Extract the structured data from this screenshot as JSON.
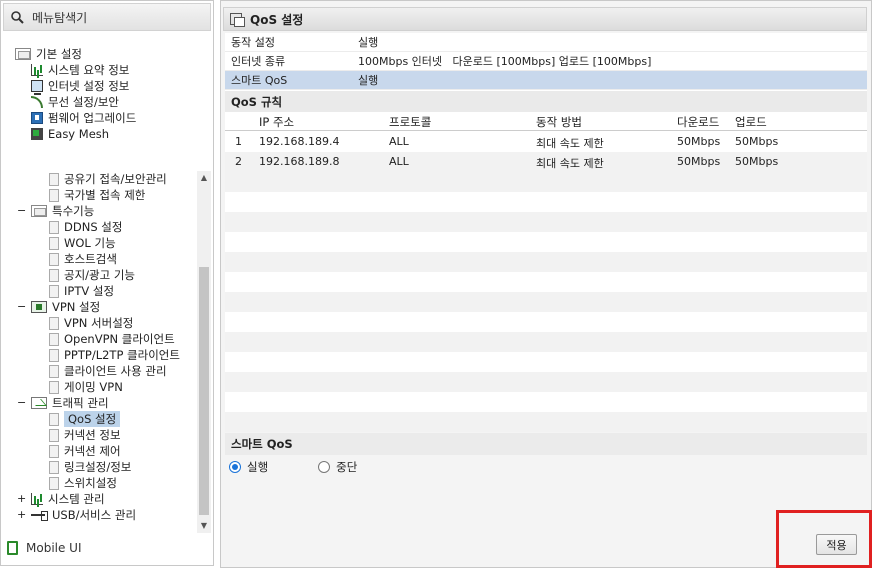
{
  "menu": {
    "title": "메뉴탐색기",
    "top_items": [
      {
        "label": "기본 설정",
        "icon": "folder-icon"
      },
      {
        "label": "시스템 요약 정보",
        "icon": "chart-icon"
      },
      {
        "label": "인터넷 설정 정보",
        "icon": "pc-icon"
      },
      {
        "label": "무선 설정/보안",
        "icon": "wifi-icon"
      },
      {
        "label": "펌웨어 업그레이드",
        "icon": "update-icon"
      },
      {
        "label": "Easy Mesh",
        "icon": "mesh-icon"
      }
    ],
    "tree": [
      {
        "label": "공유기 접속/보안관리",
        "type": "page"
      },
      {
        "label": "국가별 접속 제한",
        "type": "page"
      },
      {
        "label": "특수기능",
        "type": "folder",
        "toggle": "−"
      },
      {
        "label": "DDNS 설정",
        "type": "page"
      },
      {
        "label": "WOL 기능",
        "type": "page"
      },
      {
        "label": "호스트검색",
        "type": "page"
      },
      {
        "label": "공지/광고 기능",
        "type": "page"
      },
      {
        "label": "IPTV 설정",
        "type": "page"
      },
      {
        "label": "VPN 설정",
        "type": "vpn",
        "toggle": "−"
      },
      {
        "label": "VPN 서버설정",
        "type": "page"
      },
      {
        "label": "OpenVPN 클라이언트",
        "type": "page"
      },
      {
        "label": "PPTP/L2TP 클라이언트",
        "type": "page"
      },
      {
        "label": "클라이언트 사용 관리",
        "type": "page"
      },
      {
        "label": "게이밍 VPN",
        "type": "page"
      },
      {
        "label": "트래픽 관리",
        "type": "mail",
        "toggle": "−"
      },
      {
        "label": "QoS 설정",
        "type": "page",
        "selected": true
      },
      {
        "label": "커넥션 정보",
        "type": "page"
      },
      {
        "label": "커넥션 제어",
        "type": "page"
      },
      {
        "label": "링크설정/정보",
        "type": "page"
      },
      {
        "label": "스위치설정",
        "type": "page"
      },
      {
        "label": "시스템 관리",
        "type": "chart",
        "toggle": "+"
      },
      {
        "label": "USB/서비스 관리",
        "type": "usb",
        "toggle": "+"
      }
    ],
    "mobile_label": "Mobile UI"
  },
  "panel": {
    "title": "QoS 설정",
    "info": [
      {
        "key": "동작 설정",
        "value": "실행"
      },
      {
        "key": "인터넷 종류",
        "value": "100Mbps 인터넷   다운로드 [100Mbps] 업로드 [100Mbps]"
      },
      {
        "key": "스마트 QoS",
        "value": "실행",
        "highlight": true
      }
    ],
    "rules_title": "QoS 규칙",
    "columns": [
      "IP 주소",
      "프로토콜",
      "동작 방법",
      "다운로드",
      "업로드"
    ],
    "rules": [
      {
        "no": "1",
        "ip": "192.168.189.4",
        "proto": "ALL",
        "method": "최대 속도 제한",
        "down": "50Mbps",
        "up": "50Mbps"
      },
      {
        "no": "2",
        "ip": "192.168.189.8",
        "proto": "ALL",
        "method": "최대 속도 제한",
        "down": "50Mbps",
        "up": "50Mbps"
      }
    ],
    "smart_qos_title": "스마트 QoS",
    "radio_on": "실행",
    "radio_off": "중단",
    "selected_radio": "실행",
    "apply_label": "적용"
  },
  "colors": {
    "selected_row": "#bcd3ea",
    "highlight_row": "#c8d8ec",
    "annotation_box": "#e02020"
  }
}
